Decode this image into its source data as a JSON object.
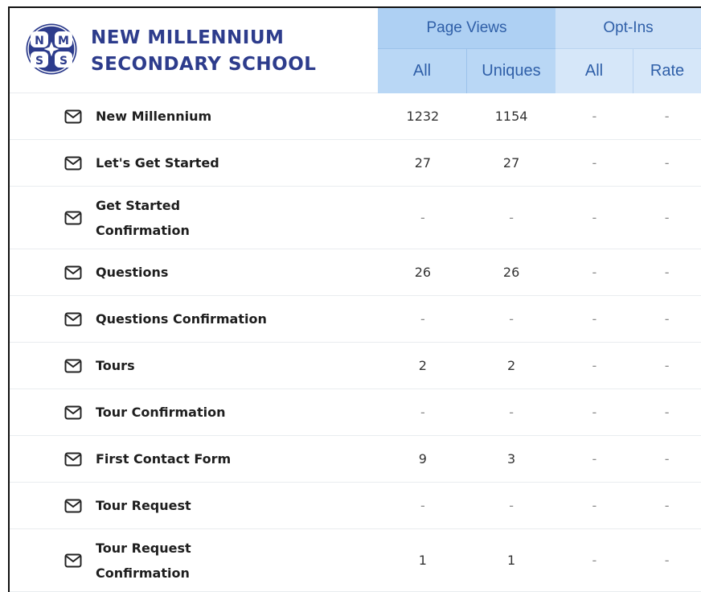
{
  "brand": {
    "logo_letters": [
      "N",
      "M",
      "S",
      "S"
    ],
    "line1": "NEW MILLENNIUM",
    "line2": "SECONDARY SCHOOL",
    "color": "#2d3c8c"
  },
  "columns": {
    "page_views": {
      "label": "Page Views",
      "all": "All",
      "uniques": "Uniques"
    },
    "opt_ins": {
      "label": "Opt-Ins",
      "all": "All",
      "rate": "Rate"
    }
  },
  "rows": [
    {
      "name": "New Millennium",
      "pv_all": "1232",
      "pv_uniques": "1154",
      "oi_all": "-",
      "oi_rate": "-"
    },
    {
      "name": "Let's Get Started",
      "pv_all": "27",
      "pv_uniques": "27",
      "oi_all": "-",
      "oi_rate": "-"
    },
    {
      "name": "Get Started Confirmation",
      "pv_all": "-",
      "pv_uniques": "-",
      "oi_all": "-",
      "oi_rate": "-"
    },
    {
      "name": "Questions",
      "pv_all": "26",
      "pv_uniques": "26",
      "oi_all": "-",
      "oi_rate": "-"
    },
    {
      "name": "Questions Confirmation",
      "pv_all": "-",
      "pv_uniques": "-",
      "oi_all": "-",
      "oi_rate": "-"
    },
    {
      "name": "Tours",
      "pv_all": "2",
      "pv_uniques": "2",
      "oi_all": "-",
      "oi_rate": "-"
    },
    {
      "name": "Tour Confirmation",
      "pv_all": "-",
      "pv_uniques": "-",
      "oi_all": "-",
      "oi_rate": "-"
    },
    {
      "name": "First Contact Form",
      "pv_all": "9",
      "pv_uniques": "3",
      "oi_all": "-",
      "oi_rate": "-"
    },
    {
      "name": "Tour Request",
      "pv_all": "-",
      "pv_uniques": "-",
      "oi_all": "-",
      "oi_rate": "-"
    },
    {
      "name": "Tour Request Confirmation",
      "pv_all": "1",
      "pv_uniques": "1",
      "oi_all": "-",
      "oi_rate": "-"
    }
  ],
  "icons": {
    "row_icon": "envelope-icon"
  },
  "colors": {
    "page_views_header": "#aed0f3",
    "opt_ins_header": "#cde1f7",
    "header_text": "#2f5fa8"
  }
}
